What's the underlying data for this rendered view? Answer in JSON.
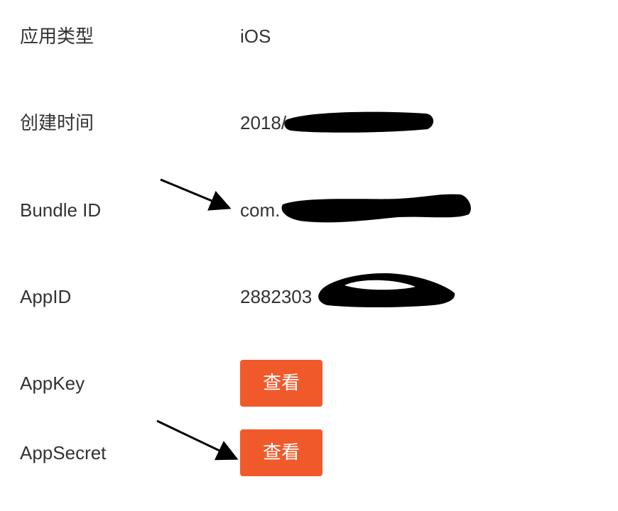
{
  "rows": [
    {
      "label": "应用类型",
      "value": "iOS"
    },
    {
      "label": "创建时间",
      "value": "2018/"
    },
    {
      "label": "Bundle ID",
      "value": "com."
    },
    {
      "label": "AppID",
      "value": "2882303"
    },
    {
      "label": "AppKey",
      "button_label": "查看"
    },
    {
      "label": "AppSecret",
      "button_label": "查看"
    }
  ],
  "colors": {
    "button_bg": "#f05a2b",
    "button_text": "#ffffff",
    "text": "#333333",
    "redaction": "#000000",
    "arrow": "#000000"
  },
  "annotations": {
    "redacted_fields": [
      "创建时间",
      "Bundle ID",
      "AppID"
    ],
    "arrows_point_to": [
      "Bundle ID",
      "AppSecret"
    ]
  }
}
